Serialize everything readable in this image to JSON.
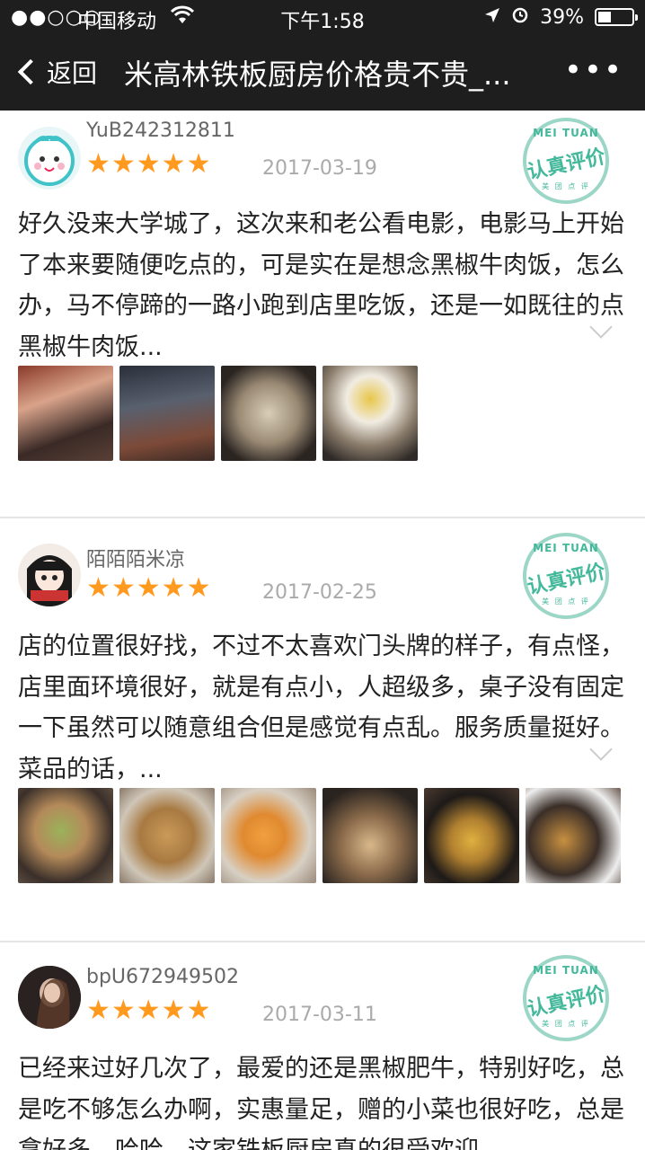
{
  "status": {
    "signal": "●●○○○",
    "carrier": "中国移动",
    "time": "下午1:58",
    "battery": "39%",
    "battery_level": 0.39
  },
  "nav": {
    "back_label": "返回",
    "title": "米高林铁板厨房价格贵不贵_...",
    "more": "•••"
  },
  "stamp": {
    "top": "MEI TUAN",
    "middle": "认真评价",
    "bottom": "美 团 点 评"
  },
  "reviews": [
    {
      "username": "YuB242312811",
      "stars": "★★★★★",
      "date": "2017-03-19",
      "text": "好久没来大学城了，这次来和老公看电影，电影马上开始了本来要随便吃点的，可是实在是想念黑椒牛肉饭，怎么办，马不停蹄的一路小跑到店里吃饭，还是一如既往的点黑椒牛肉饭..."
    },
    {
      "username": "陌陌陌米凉",
      "stars": "★★★★★",
      "date": "2017-02-25",
      "text": "店的位置很好找，不过不太喜欢门头牌的样子，有点怪，店里面环境很好，就是有点小，人超级多，桌子没有固定一下虽然可以随意组合但是感觉有点乱。服务质量挺好。菜品的话，..."
    },
    {
      "username": "bpU672949502",
      "stars": "★★★★★",
      "date": "2017-03-11",
      "text": "已经来过好几次了，最爱的还是黑椒肥牛，特别好吃，总是吃不够怎么办啊，实惠量足，赠的小菜也很好吃，总是拿好多，哈哈，这家铁板厨房真的很受欢迎"
    }
  ]
}
